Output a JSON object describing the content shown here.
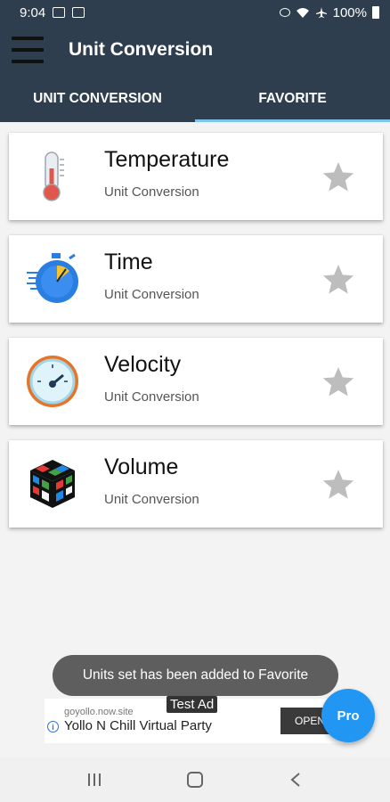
{
  "status_bar": {
    "time": "9:04",
    "battery": "100%"
  },
  "app_bar": {
    "title": "Unit Conversion"
  },
  "tabs": [
    {
      "label": "UNIT CONVERSION",
      "active": false
    },
    {
      "label": "FAVORITE",
      "active": true
    }
  ],
  "favorites": [
    {
      "title": "Temperature",
      "subtitle": "Unit Conversion",
      "icon": "thermometer-icon"
    },
    {
      "title": "Time",
      "subtitle": "Unit Conversion",
      "icon": "stopwatch-icon"
    },
    {
      "title": "Velocity",
      "subtitle": "Unit Conversion",
      "icon": "speedometer-icon"
    },
    {
      "title": "Volume",
      "subtitle": "Unit Conversion",
      "icon": "cube-icon"
    }
  ],
  "toast": "Units set has been added to Favorite",
  "ad": {
    "badge": "Test Ad",
    "domain": "goyollo.now.site",
    "title": "Yollo N Chill Virtual Party",
    "cta": "OPEN"
  },
  "fab": {
    "label": "Pro"
  },
  "colors": {
    "primary": "#2e3e4e",
    "tab_indicator": "#7ec4ec",
    "fab": "#2196f3",
    "star": "#bdbdbd"
  }
}
